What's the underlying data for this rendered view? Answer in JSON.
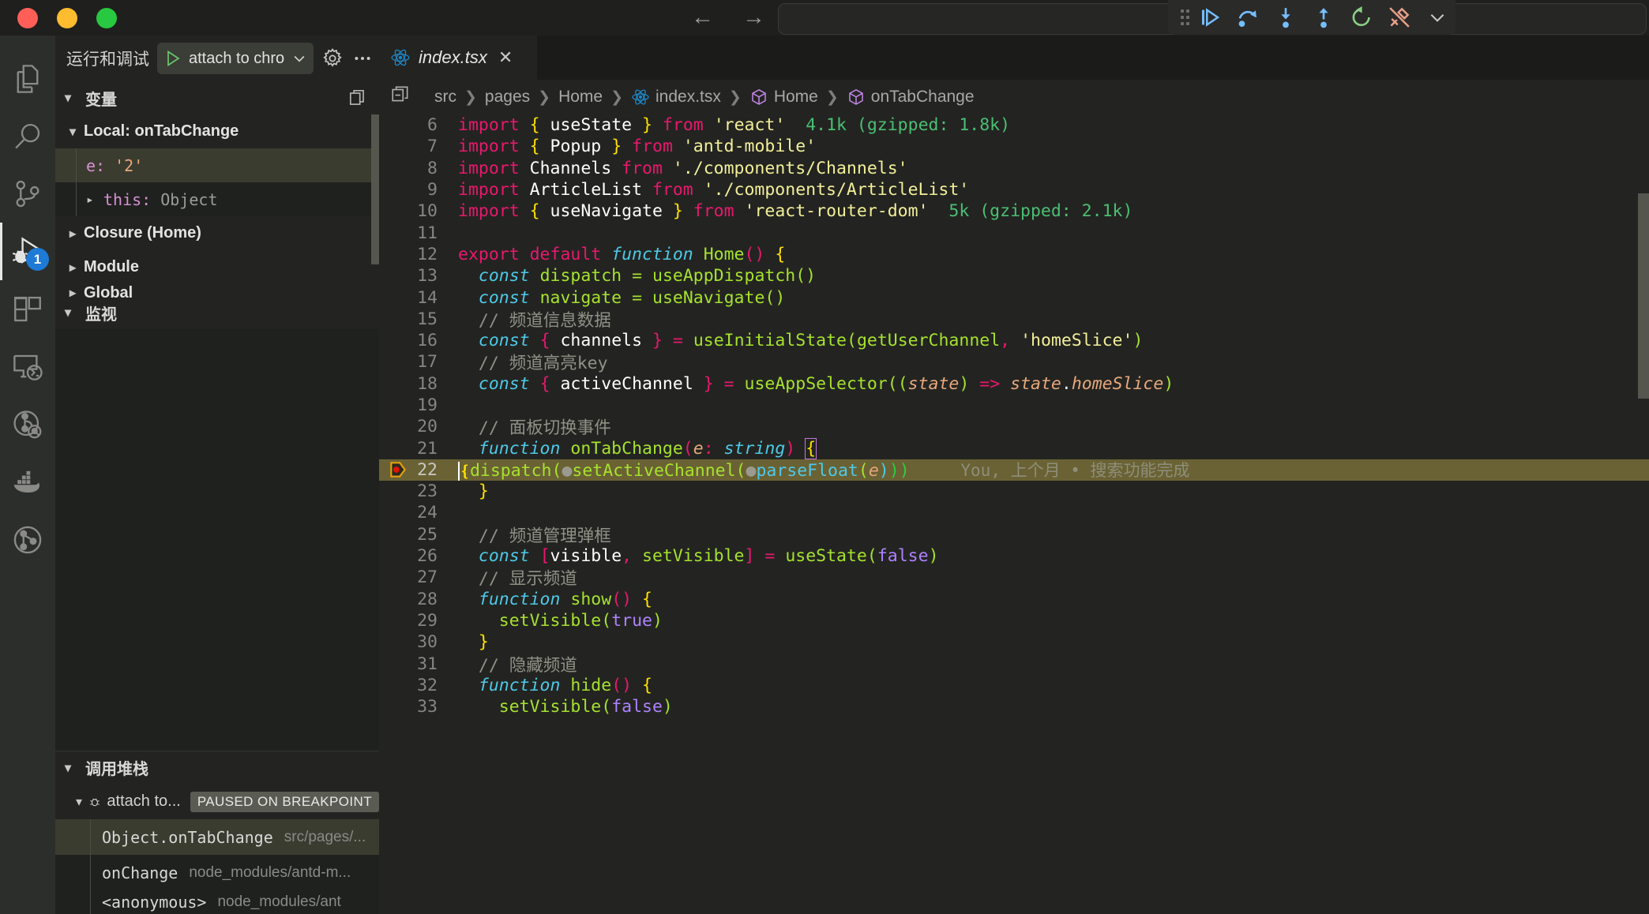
{
  "titlebar": {
    "traffic_lights": [
      "close",
      "minimize",
      "maximize"
    ],
    "nav_back": "←",
    "nav_forward": "→"
  },
  "debug_toolbar": {
    "buttons": [
      {
        "name": "continue",
        "title": "继续"
      },
      {
        "name": "step-over",
        "title": "单步跳过"
      },
      {
        "name": "step-into",
        "title": "单步调入"
      },
      {
        "name": "step-out",
        "title": "单步跳出"
      },
      {
        "name": "restart",
        "title": "重新启动"
      },
      {
        "name": "disconnect",
        "title": "断开连接"
      },
      {
        "name": "more",
        "title": "更多"
      }
    ]
  },
  "activitybar": {
    "items": [
      {
        "name": "explorer",
        "label": "资源管理器",
        "active": false,
        "badge": null
      },
      {
        "name": "search",
        "label": "搜索",
        "active": false,
        "badge": null
      },
      {
        "name": "source-control",
        "label": "源代码管理",
        "active": false,
        "badge": null
      },
      {
        "name": "run-and-debug",
        "label": "运行和调试",
        "active": true,
        "badge": "1"
      },
      {
        "name": "extensions",
        "label": "扩展",
        "active": false,
        "badge": null
      },
      {
        "name": "remote-explorer",
        "label": "远程资源管理器",
        "active": false,
        "badge": null
      },
      {
        "name": "git-graph",
        "label": "Git Graph",
        "active": false,
        "badge": null
      },
      {
        "name": "docker",
        "label": "Docker",
        "active": false,
        "badge": null
      },
      {
        "name": "git-lens",
        "label": "GitLens",
        "active": false,
        "badge": null
      }
    ]
  },
  "sidepanel": {
    "title": "运行和调试",
    "launch_config": "attach to chro",
    "gear_icon": "gear-icon",
    "more_icon": "ellipsis-icon",
    "variables": {
      "section_label": "变量",
      "action_icon": "copy-icon",
      "rows": [
        {
          "kind": "scope",
          "expanded": true,
          "label": "Local: onTabChange",
          "selected": false
        },
        {
          "kind": "var",
          "name": "e:",
          "value": "'2'",
          "value_type": "string",
          "selected": true,
          "expandable": false
        },
        {
          "kind": "var",
          "name": "this:",
          "value": "Object",
          "value_type": "object",
          "selected": false,
          "expandable": true
        },
        {
          "kind": "scope",
          "expanded": false,
          "label": "Closure (Home)",
          "selected": false
        },
        {
          "kind": "scope",
          "expanded": false,
          "label": "Module",
          "selected": false
        },
        {
          "kind": "scope",
          "expanded": false,
          "label": "Global",
          "selected": false
        }
      ]
    },
    "watch": {
      "section_label": "监视",
      "items": []
    },
    "callstack": {
      "section_label": "调用堆栈",
      "session": {
        "label": "attach to...",
        "badge": "PAUSED ON BREAKPOINT",
        "icon": "debug-bug-icon"
      },
      "frames": [
        {
          "name": "Object.onTabChange",
          "path": "src/pages/...",
          "selected": true
        },
        {
          "name": "onChange",
          "path": "node_modules/antd-m...",
          "selected": false
        },
        {
          "name": "<anonymous>",
          "path": "node_modules/ant",
          "selected": false
        }
      ]
    }
  },
  "editor": {
    "tab": {
      "label": "index.tsx",
      "icon": "react-icon",
      "close_icon": "close-icon"
    },
    "breadcrumbs": [
      {
        "label": "src",
        "icon": null
      },
      {
        "label": "pages",
        "icon": null
      },
      {
        "label": "Home",
        "icon": null
      },
      {
        "label": "index.tsx",
        "icon": "react-icon"
      },
      {
        "label": "Home",
        "icon": "symbol-cube-icon"
      },
      {
        "label": "onTabChange",
        "icon": "symbol-cube-icon"
      }
    ],
    "breadcrumb_left_icon": "split-editor-icon",
    "first_line_number": 6,
    "current_line": 22,
    "breakpoint_line": 22,
    "blame_annotation": "You, 上个月 • 搜索功能完成",
    "lines": [
      {
        "n": 6,
        "text": "import { useState } from 'react'",
        "hint": "4.1k (gzipped: 1.8k)"
      },
      {
        "n": 7,
        "text": "import { Popup } from 'antd-mobile'",
        "hint": ""
      },
      {
        "n": 8,
        "text": "import Channels from './components/Channels'",
        "hint": ""
      },
      {
        "n": 9,
        "text": "import ArticleList from './components/ArticleList'",
        "hint": ""
      },
      {
        "n": 10,
        "text": "import { useNavigate } from 'react-router-dom'",
        "hint": "5k (gzipped: 2.1k)"
      },
      {
        "n": 11,
        "text": "",
        "hint": ""
      },
      {
        "n": 12,
        "text": "export default function Home() {",
        "hint": ""
      },
      {
        "n": 13,
        "text": "  const dispatch = useAppDispatch()",
        "hint": ""
      },
      {
        "n": 14,
        "text": "  const navigate = useNavigate()",
        "hint": ""
      },
      {
        "n": 15,
        "text": "  // 频道信息数据",
        "hint": ""
      },
      {
        "n": 16,
        "text": "  const { channels } = useInitialState(getUserChannel, 'homeSlice')",
        "hint": ""
      },
      {
        "n": 17,
        "text": "  // 频道高亮key",
        "hint": ""
      },
      {
        "n": 18,
        "text": "  const { activeChannel } = useAppSelector((state) => state.homeSlice)",
        "hint": ""
      },
      {
        "n": 19,
        "text": "",
        "hint": ""
      },
      {
        "n": 20,
        "text": "  // 面板切换事件",
        "hint": ""
      },
      {
        "n": 21,
        "text": "  function onTabChange(e: string) {",
        "hint": ""
      },
      {
        "n": 22,
        "text": "    dispatch(setActiveChannel(parseFloat(e)))",
        "hint": ""
      },
      {
        "n": 23,
        "text": "  }",
        "hint": ""
      },
      {
        "n": 24,
        "text": "",
        "hint": ""
      },
      {
        "n": 25,
        "text": "  // 频道管理弹框",
        "hint": ""
      },
      {
        "n": 26,
        "text": "  const [visible, setVisible] = useState(false)",
        "hint": ""
      },
      {
        "n": 27,
        "text": "  // 显示频道",
        "hint": ""
      },
      {
        "n": 28,
        "text": "  function show() {",
        "hint": ""
      },
      {
        "n": 29,
        "text": "    setVisible(true)",
        "hint": ""
      },
      {
        "n": 30,
        "text": "  }",
        "hint": ""
      },
      {
        "n": 31,
        "text": "  // 隐藏频道",
        "hint": ""
      },
      {
        "n": 32,
        "text": "  function hide() {",
        "hint": ""
      },
      {
        "n": 33,
        "text": "    setVisible(false)",
        "hint": ""
      }
    ]
  },
  "colors": {
    "editor_bg": "#232421",
    "panel_bg": "#1f211e",
    "activitybar_bg": "#2c2e2b",
    "accent_badge": "#1d7ad6",
    "current_line": "#6a6234",
    "selection": "#3b3c30",
    "keyword": "#e8186e",
    "string": "#f2ef9a",
    "function": "#a6e22e",
    "comment": "#8f9186",
    "type": "#4ec9e8",
    "breakpoint": "#e51400"
  }
}
